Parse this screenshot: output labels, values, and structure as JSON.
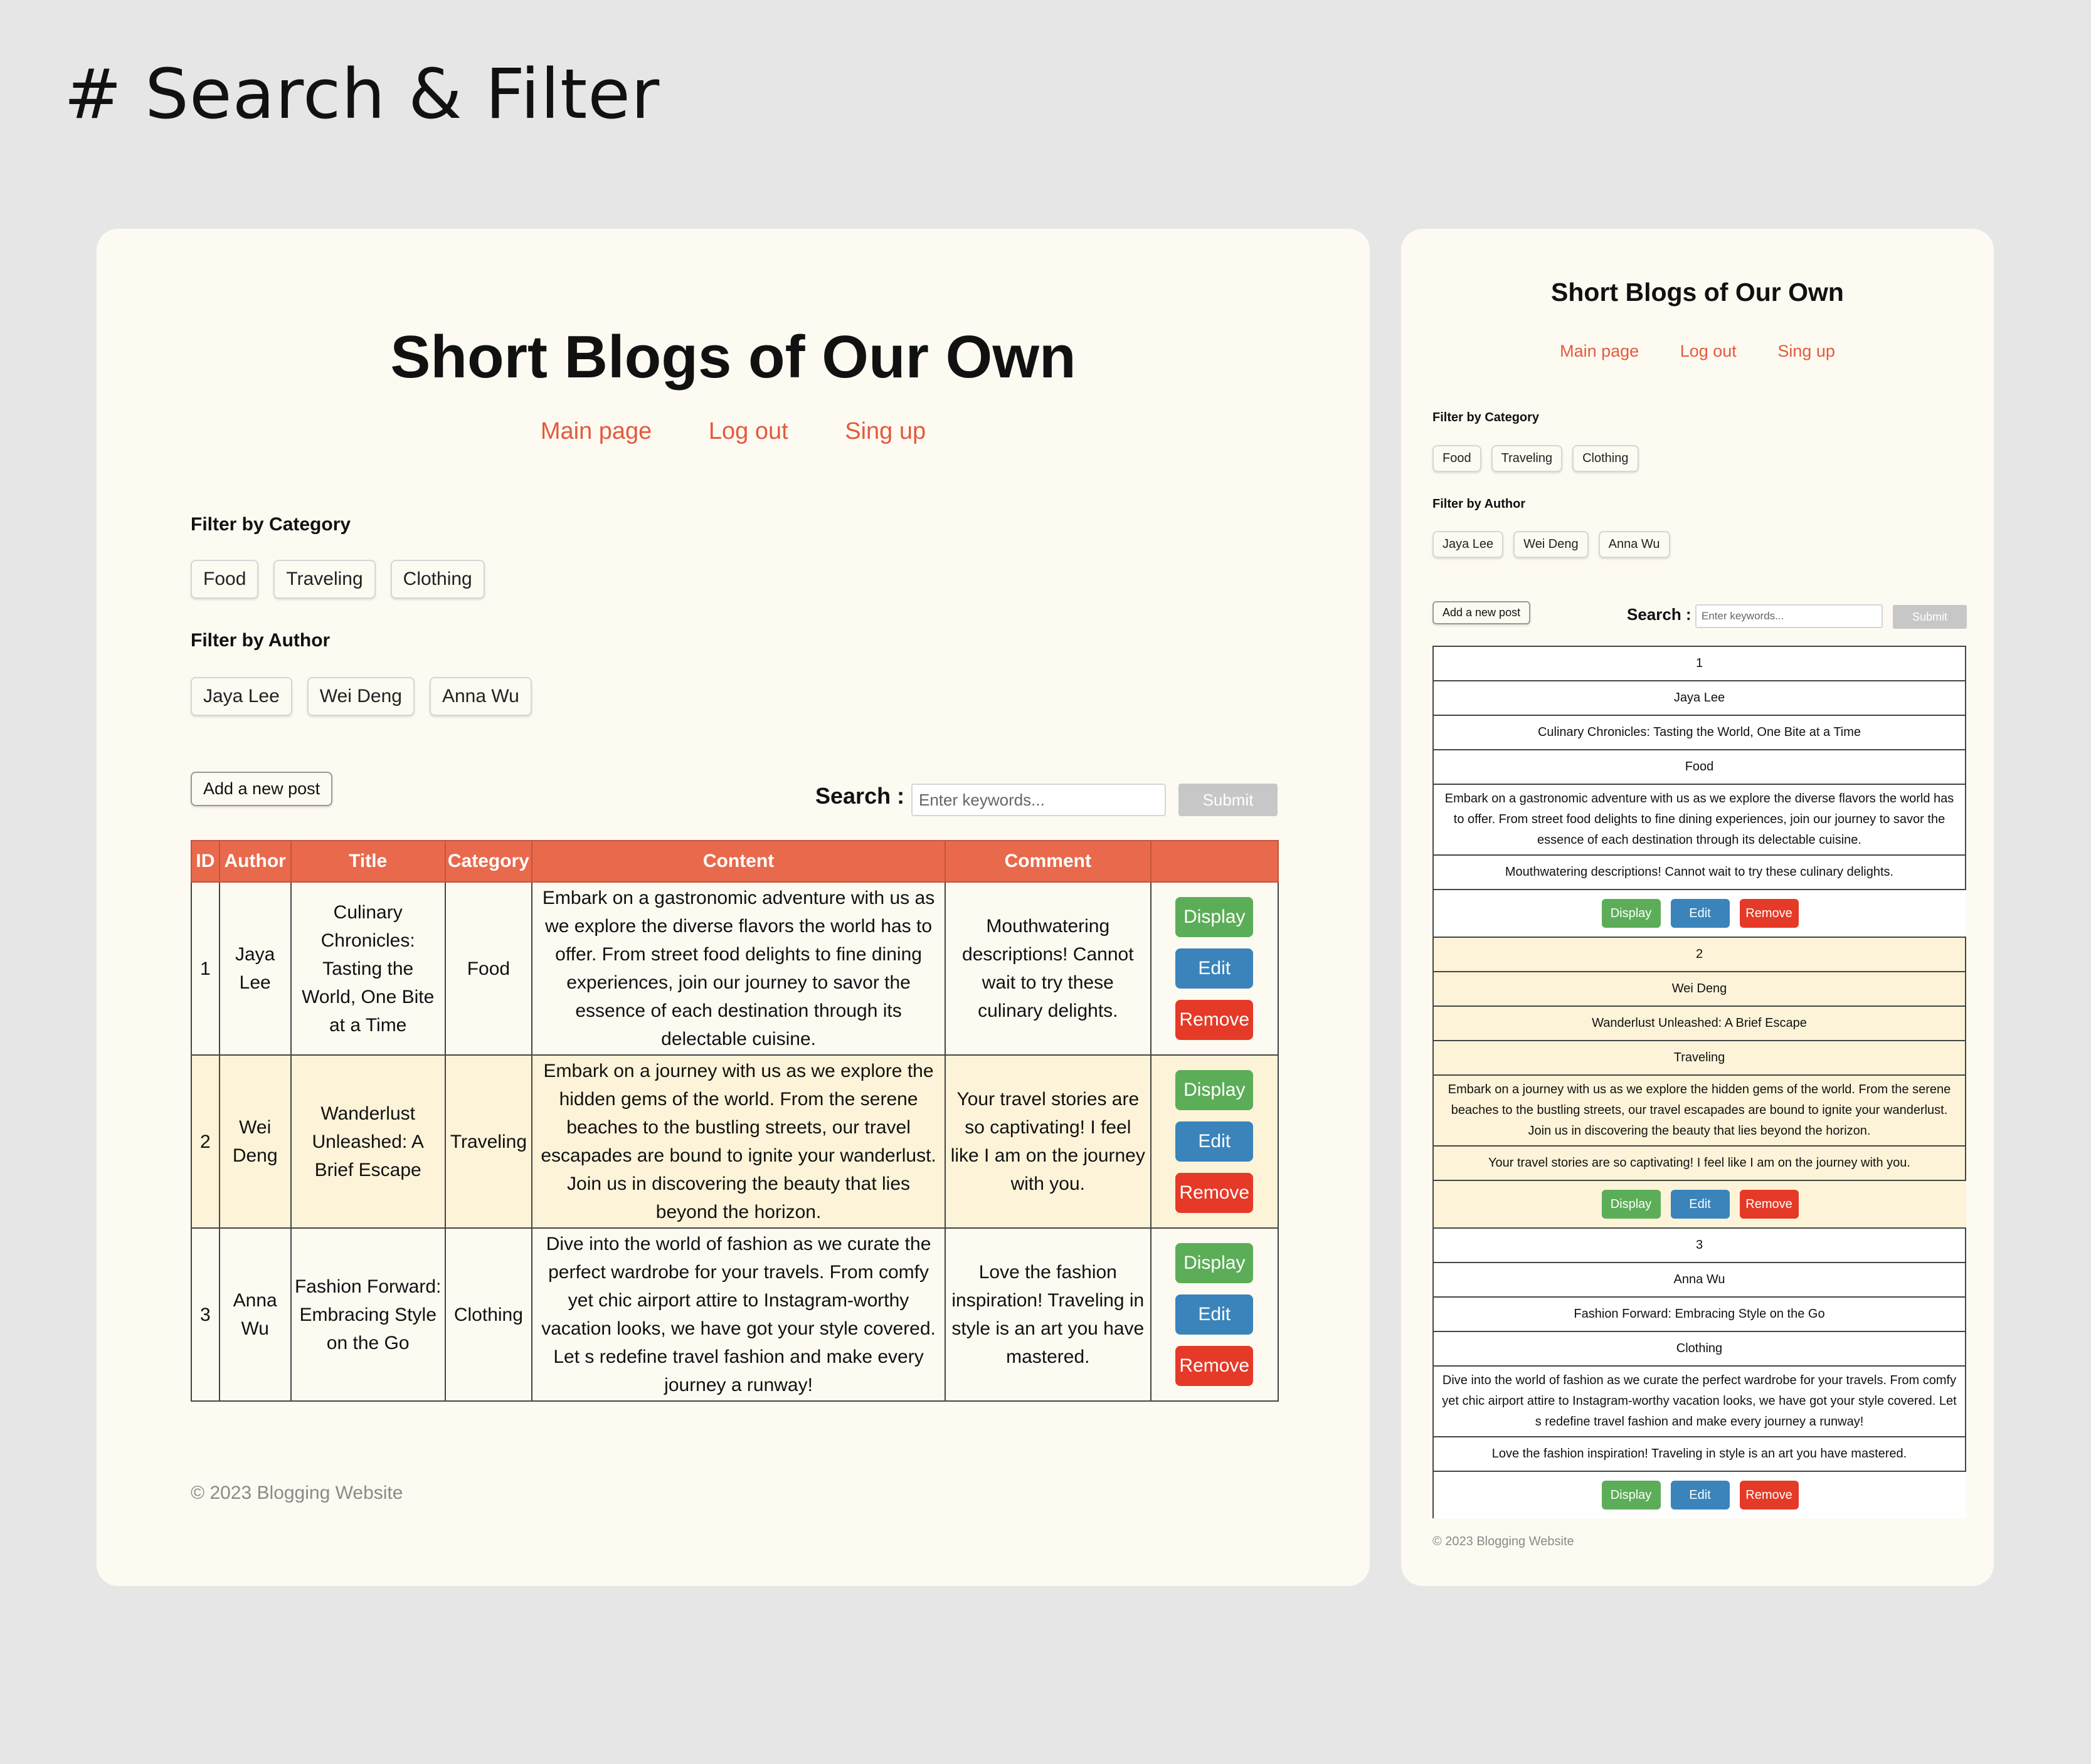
{
  "page_heading": "# Search & Filter",
  "site": {
    "title": "Short Blogs of Our Own",
    "nav": [
      "Main page",
      "Log out",
      "Sing up"
    ]
  },
  "filters": {
    "category_label": "Filter by Category",
    "categories": [
      "Food",
      "Traveling",
      "Clothing"
    ],
    "author_label": "Filter by Author",
    "authors": [
      "Jaya Lee",
      "Wei Deng",
      "Anna Wu"
    ]
  },
  "toolbar": {
    "add_post": "Add a new post",
    "search_label": "Search :",
    "search_placeholder": "Enter keywords...",
    "submit": "Submit"
  },
  "table": {
    "headers": [
      "ID",
      "Author",
      "Title",
      "Category",
      "Content",
      "Comment",
      ""
    ],
    "actions": [
      "Display",
      "Edit",
      "Remove"
    ],
    "rows": [
      {
        "id": "1",
        "author": "Jaya Lee",
        "title": "Culinary Chronicles: Tasting the World, One Bite at a Time",
        "category": "Food",
        "content": "Embark on a gastronomic adventure with us as we explore the diverse flavors the world has to offer. From street food delights to fine dining experiences, join our journey to savor the essence of each destination through its delectable cuisine.",
        "comment": "Mouthwatering descriptions! Cannot wait to try these culinary delights."
      },
      {
        "id": "2",
        "author": "Wei Deng",
        "title": "Wanderlust Unleashed: A Brief Escape",
        "category": "Traveling",
        "content": "Embark on a journey with us as we explore the hidden gems of the world. From the serene beaches to the bustling streets, our travel escapades are bound to ignite your wanderlust. Join us in discovering the beauty that lies beyond the horizon.",
        "comment": "Your travel stories are so captivating! I feel like I am on the journey with you."
      },
      {
        "id": "3",
        "author": "Anna Wu",
        "title": "Fashion Forward: Embracing Style on the Go",
        "category": "Clothing",
        "content": "Dive into the world of fashion as we curate the perfect wardrobe for your travels. From comfy yet chic airport attire to Instagram-worthy vacation looks, we have got your style covered. Let s redefine travel fashion and make every journey a runway!",
        "comment": "Love the fashion inspiration! Traveling in style is an art you have mastered."
      }
    ]
  },
  "footer": "© 2023 Blogging Website",
  "colors": {
    "background": "#e6e6e6",
    "panel": "#fdfaf2",
    "accent": "#e45a3c",
    "table_header": "#e9694c",
    "row_alt": "#fdf3d8",
    "display": "#5cad58",
    "edit": "#3a84bb",
    "remove": "#e53a27"
  }
}
